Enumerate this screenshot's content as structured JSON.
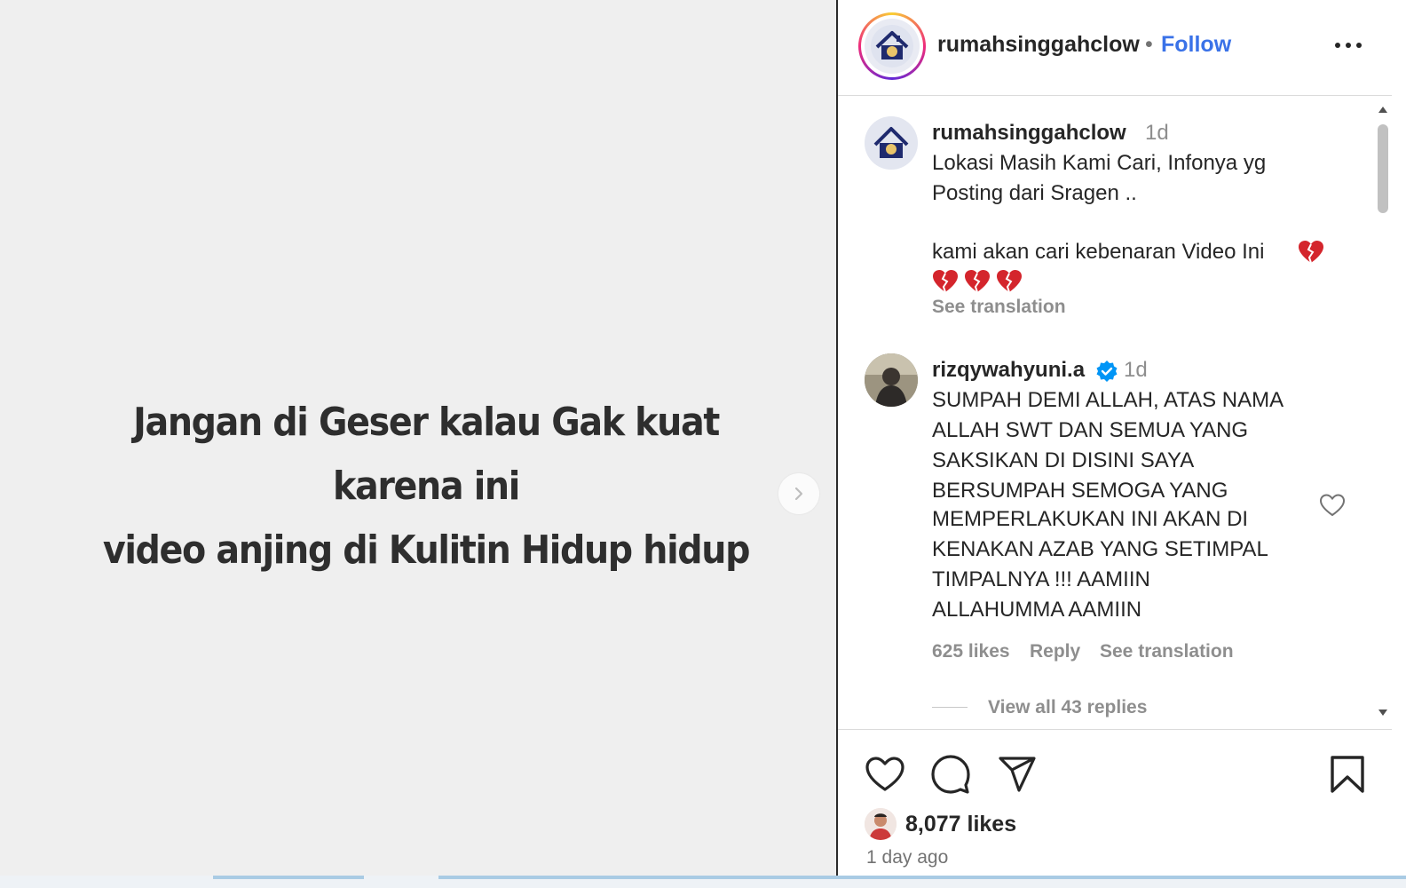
{
  "media": {
    "caption_line1": "Jangan di Geser  kalau Gak kuat karena ini",
    "caption_line2": "video anjing di Kulitin Hidup hidup",
    "next_icon": "chevron-right-icon"
  },
  "header": {
    "username": "rumahsinggahclow",
    "separator": "•",
    "follow_label": "Follow",
    "more_icon": "more-horizontal-icon",
    "accent_color": "#3a72e8"
  },
  "comments": [
    {
      "username": "rumahsinggahclow",
      "time": "1d",
      "text_line1": "Lokasi Masih Kami Cari, Infonya yg",
      "text_line2": "Posting dari Sragen ..",
      "text_line3": "kami akan cari kebenaran Video Ini",
      "emoji": "broken-heart-icon",
      "see_translation": "See translation"
    },
    {
      "username": "rizqywahyuni.a",
      "verified": true,
      "time": "1d",
      "lines": [
        "SUMPAH DEMI ALLAH, ATAS NAMA",
        "ALLAH SWT DAN SEMUA YANG",
        "SAKSIKAN DI DISINI SAYA",
        "BERSUMPAH SEMOGA YANG",
        "MEMPERLAKUKAN INI AKAN DI",
        "KENAKAN AZAB YANG SETIMPAL",
        "TIMPALNYA !!! AAMIIN",
        "ALLAHUMMA AAMIIN"
      ],
      "likes": "625 likes",
      "reply": "Reply",
      "see_translation": "See translation",
      "view_replies": "View all 43 replies"
    }
  ],
  "footer": {
    "icons": [
      "heart-icon",
      "comment-icon",
      "share-icon",
      "bookmark-icon"
    ],
    "likes": "8,077 likes",
    "time_ago": "1 day ago"
  }
}
